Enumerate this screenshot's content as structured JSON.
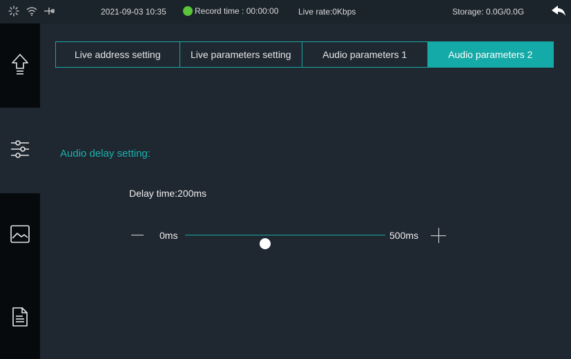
{
  "status_bar": {
    "loading_icon": "loading-spinner-icon",
    "wifi_icon": "wifi-icon",
    "usb_icon": "usb-icon",
    "datetime": "2021-09-03 10:35",
    "record_time": "Record time : 00:00:00",
    "record_status_color": "#5cc43a",
    "live_rate": "Live rate:0Kbps",
    "storage": "Storage: 0.0G/0.0G",
    "back_icon": "back-arrow-icon"
  },
  "sidebar": {
    "items": [
      {
        "icon": "upload-icon"
      },
      {
        "icon": "sliders-icon"
      },
      {
        "icon": "image-icon"
      },
      {
        "icon": "document-icon"
      }
    ]
  },
  "tabs": [
    {
      "label": "Live address setting",
      "active": false
    },
    {
      "label": "Live parameters setting",
      "active": false
    },
    {
      "label": "Audio parameters 1",
      "active": false
    },
    {
      "label": "Audio parameters 2",
      "active": true
    }
  ],
  "content": {
    "section_title": "Audio delay setting:",
    "delay_label": "Delay time:",
    "delay_value": "200ms",
    "slider": {
      "min_label": "0ms",
      "max_label": "500ms",
      "min": 0,
      "max": 500,
      "value": 200
    }
  },
  "colors": {
    "accent": "#14aaa7",
    "background": "#1f2730",
    "sidebar_dark": "#070a0d"
  }
}
